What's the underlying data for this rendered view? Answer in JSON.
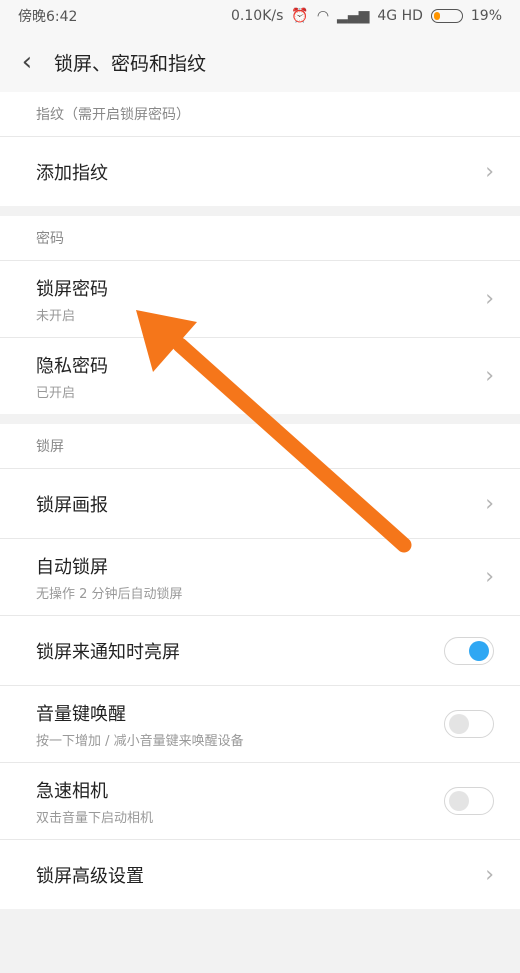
{
  "status_bar": {
    "time": "傍晚6:42",
    "speed": "0.10K/s",
    "network": "4G HD",
    "battery": "19%"
  },
  "header": {
    "back_icon": "chevron-left-icon",
    "title": "锁屏、密码和指纹"
  },
  "sections": {
    "fingerprint": {
      "heading": "指纹（需开启锁屏密码）",
      "add_fingerprint": "添加指纹"
    },
    "password": {
      "heading": "密码",
      "lock_password": {
        "label": "锁屏密码",
        "sub": "未开启"
      },
      "privacy_password": {
        "label": "隐私密码",
        "sub": "已开启"
      }
    },
    "lockscreen": {
      "heading": "锁屏",
      "wallpaper": {
        "label": "锁屏画报"
      },
      "auto_lock": {
        "label": "自动锁屏",
        "sub": "无操作 2 分钟后自动锁屏"
      },
      "notify_wake": {
        "label": "锁屏来通知时亮屏",
        "enabled": true
      },
      "volume_wake": {
        "label": "音量键唤醒",
        "sub": "按一下增加 / 减小音量键来唤醒设备",
        "enabled": false
      },
      "quick_camera": {
        "label": "急速相机",
        "sub": "双击音量下启动相机",
        "enabled": false
      },
      "advanced": {
        "label": "锁屏高级设置"
      }
    }
  },
  "annotation": {
    "arrow_color": "#f5761a"
  },
  "colors": {
    "toggle_on": "#2fa7f3"
  }
}
